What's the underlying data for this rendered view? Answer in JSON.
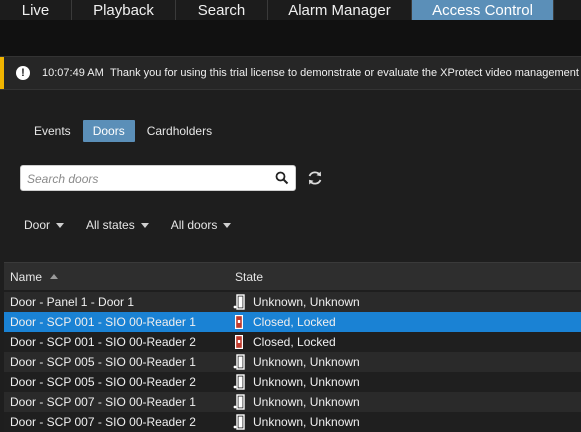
{
  "tabs": [
    {
      "label": "Live",
      "active": false
    },
    {
      "label": "Playback",
      "active": false
    },
    {
      "label": "Search",
      "active": false
    },
    {
      "label": "Alarm Manager",
      "active": false
    },
    {
      "label": "Access Control",
      "active": true
    }
  ],
  "notice": {
    "icon": "alert-icon",
    "time": "10:07:49 AM",
    "message": "Thank you for using this trial license to demonstrate or evaluate the XProtect video management sof"
  },
  "subtabs": [
    {
      "label": "Events",
      "active": false
    },
    {
      "label": "Doors",
      "active": true
    },
    {
      "label": "Cardholders",
      "active": false
    }
  ],
  "search": {
    "placeholder": "Search doors",
    "icon": "search-icon"
  },
  "refresh": {
    "icon": "refresh-icon"
  },
  "filters": [
    {
      "label": "Door"
    },
    {
      "label": "All states"
    },
    {
      "label": "All doors"
    }
  ],
  "table": {
    "columns": {
      "name": "Name",
      "state": "State"
    },
    "rows": [
      {
        "name": "Door - Panel 1 - Door 1",
        "state": "Unknown, Unknown",
        "icon": "door-unknown-icon",
        "selected": false
      },
      {
        "name": "Door - SCP 001 - SIO 00-Reader 1",
        "state": "Closed, Locked",
        "icon": "door-locked-icon",
        "selected": true
      },
      {
        "name": "Door - SCP 001 - SIO 00-Reader 2",
        "state": "Closed, Locked",
        "icon": "door-locked-icon",
        "selected": false
      },
      {
        "name": "Door - SCP 005 - SIO 00-Reader 1",
        "state": "Unknown, Unknown",
        "icon": "door-unknown-icon",
        "selected": false
      },
      {
        "name": "Door - SCP 005 - SIO 00-Reader 2",
        "state": "Unknown, Unknown",
        "icon": "door-unknown-icon",
        "selected": false
      },
      {
        "name": "Door - SCP 007 - SIO 00-Reader 1",
        "state": "Unknown, Unknown",
        "icon": "door-unknown-icon",
        "selected": false
      },
      {
        "name": "Door - SCP 007 - SIO 00-Reader 2",
        "state": "Unknown, Unknown",
        "icon": "door-unknown-icon",
        "selected": false
      }
    ]
  },
  "colors": {
    "accent": "#5b8fb8",
    "selected_row": "#1a82d4",
    "notice_bar": "#f0b400",
    "locked": "#c0392b"
  }
}
